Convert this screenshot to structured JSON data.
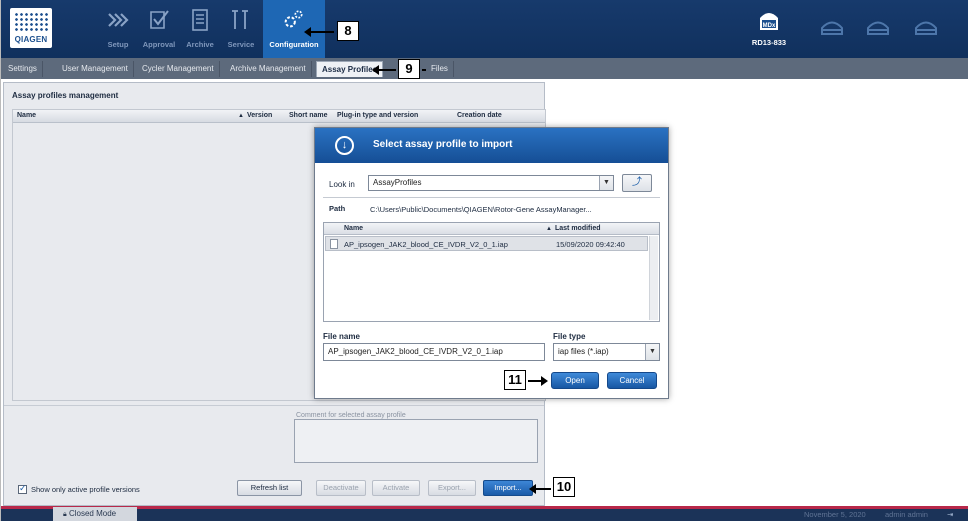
{
  "app": {
    "logo_text": "QIAGEN",
    "nav": [
      {
        "label": "Setup",
        "icon": "setup-icon"
      },
      {
        "label": "Approval",
        "icon": "approval-icon"
      },
      {
        "label": "Archive",
        "icon": "archive-icon"
      },
      {
        "label": "Service",
        "icon": "service-icon"
      },
      {
        "label": "Configuration",
        "icon": "configuration-icon",
        "active": true
      }
    ],
    "device": {
      "badge": "MDx",
      "name": "RD13-833"
    }
  },
  "subtabs": [
    "Settings",
    "User Management",
    "Cycler Management",
    "Archive Management",
    "Assay Profiles",
    "Files"
  ],
  "active_subtab": "Assay Profiles",
  "panel": {
    "title": "Assay profiles management",
    "columns": [
      "Name",
      "Version",
      "Short name",
      "Plug-in type and version",
      "Creation date"
    ],
    "sort_indicator": "▲",
    "comment_label": "Comment for selected assay profile",
    "checkbox_label": "Show only active profile versions",
    "buttons": {
      "refresh": "Refresh list",
      "deactivate": "Deactivate",
      "activate": "Activate",
      "export": "Export...",
      "import": "Import..."
    }
  },
  "dialog": {
    "title": "Select assay profile to import",
    "look_in_label": "Look in",
    "look_in_value": "AssayProfiles",
    "path_label": "Path",
    "path_value": "C:\\Users\\Public\\Documents\\QIAGEN\\Rotor-Gene AssayManager...",
    "list_columns": [
      "Name",
      "Last modified"
    ],
    "files": [
      {
        "name": "AP_ipsogen_JAK2_blood_CE_IVDR_V2_0_1.iap",
        "modified": "15/09/2020 09:42:40"
      }
    ],
    "file_name_label": "File name",
    "file_name_value": "AP_ipsogen_JAK2_blood_CE_IVDR_V2_0_1.iap",
    "file_type_label": "File type",
    "file_type_value": "iap files (*.iap)",
    "open_label": "Open",
    "cancel_label": "Cancel"
  },
  "callouts": {
    "c8": "8",
    "c9": "9",
    "c10": "10",
    "c11": "11"
  },
  "status": {
    "mode": "Closed Mode",
    "date": "November 5, 2020",
    "user": "admin admin"
  }
}
